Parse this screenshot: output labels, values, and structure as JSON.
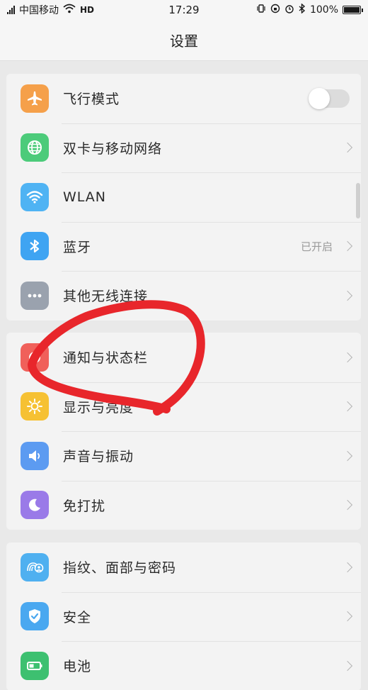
{
  "status_bar": {
    "carrier": "中国移动",
    "network": "HD",
    "time": "17:29",
    "battery_percent_text": "100%",
    "battery_level": 1.0,
    "icons": [
      "signal-icon",
      "wifi-icon",
      "hd-icon",
      "vibrate-icon",
      "rotation-lock-icon",
      "alarm-icon",
      "bluetooth-icon",
      "battery-icon"
    ]
  },
  "header": {
    "title": "设置"
  },
  "groups": [
    {
      "items": [
        {
          "label": "飞行模式",
          "icon": "airplane-icon",
          "color": "#F5A04A",
          "control": "toggle",
          "toggle_on": false
        },
        {
          "label": "双卡与移动网络",
          "icon": "globe-icon",
          "color": "#4CCB7A",
          "control": "chevron"
        },
        {
          "label": "WLAN",
          "icon": "wifi-icon",
          "color": "#4FB3F3",
          "control": "none"
        },
        {
          "label": "蓝牙",
          "icon": "bluetooth-icon",
          "color": "#3FA4F2",
          "control": "chevron",
          "status": "已开启"
        },
        {
          "label": "其他无线连接",
          "icon": "more-dots-icon",
          "color": "#9AA2AE",
          "control": "chevron"
        }
      ]
    },
    {
      "items": [
        {
          "label": "通知与状态栏",
          "icon": "notification-icon",
          "color": "#F0605A",
          "control": "chevron"
        },
        {
          "label": "显示与亮度",
          "icon": "brightness-icon",
          "color": "#F6C133",
          "control": "chevron"
        },
        {
          "label": "声音与振动",
          "icon": "speaker-icon",
          "color": "#5C9BF1",
          "control": "chevron"
        },
        {
          "label": "免打扰",
          "icon": "moon-icon",
          "color": "#9A7AE8",
          "control": "chevron"
        }
      ]
    },
    {
      "items": [
        {
          "label": "指纹、面部与密码",
          "icon": "fingerprint-face-icon",
          "color": "#4FB0F0",
          "control": "chevron"
        },
        {
          "label": "安全",
          "icon": "shield-icon",
          "color": "#4AA8F0",
          "control": "chevron"
        },
        {
          "label": "电池",
          "icon": "battery-icon",
          "color": "#3DC070",
          "control": "chevron"
        }
      ]
    }
  ],
  "annotation": {
    "color": "#E8262B"
  }
}
